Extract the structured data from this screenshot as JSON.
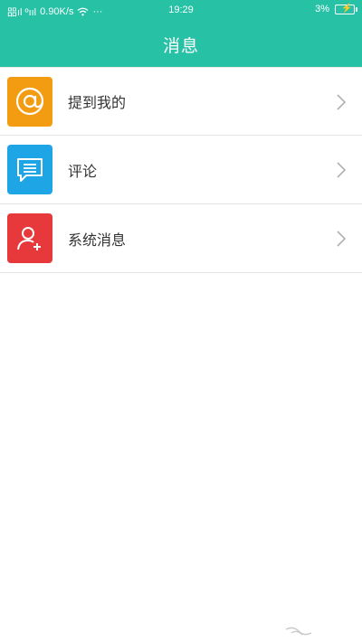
{
  "status_bar": {
    "signal_text": "㗊ıl ºııl",
    "speed": "0.90K/s",
    "more": "···",
    "time": "19:29",
    "battery": "3%"
  },
  "header": {
    "title": "消息"
  },
  "messages": {
    "items": [
      {
        "label": "提到我的",
        "icon": "at-icon",
        "color": "#f39c12"
      },
      {
        "label": "评论",
        "icon": "comment-icon",
        "color": "#1ea5e6"
      },
      {
        "label": "系统消息",
        "icon": "user-add-icon",
        "color": "#e7383b"
      }
    ]
  },
  "colors": {
    "accent": "#27c1a6"
  }
}
